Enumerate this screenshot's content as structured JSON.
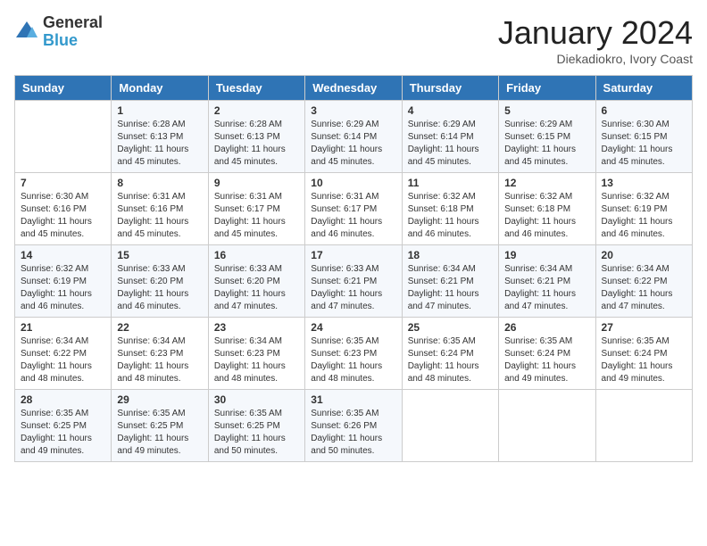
{
  "logo": {
    "general": "General",
    "blue": "Blue"
  },
  "title": "January 2024",
  "subtitle": "Diekadiokro, Ivory Coast",
  "weekdays": [
    "Sunday",
    "Monday",
    "Tuesday",
    "Wednesday",
    "Thursday",
    "Friday",
    "Saturday"
  ],
  "weeks": [
    [
      {
        "day": "",
        "text": ""
      },
      {
        "day": "1",
        "text": "Sunrise: 6:28 AM\nSunset: 6:13 PM\nDaylight: 11 hours\nand 45 minutes."
      },
      {
        "day": "2",
        "text": "Sunrise: 6:28 AM\nSunset: 6:13 PM\nDaylight: 11 hours\nand 45 minutes."
      },
      {
        "day": "3",
        "text": "Sunrise: 6:29 AM\nSunset: 6:14 PM\nDaylight: 11 hours\nand 45 minutes."
      },
      {
        "day": "4",
        "text": "Sunrise: 6:29 AM\nSunset: 6:14 PM\nDaylight: 11 hours\nand 45 minutes."
      },
      {
        "day": "5",
        "text": "Sunrise: 6:29 AM\nSunset: 6:15 PM\nDaylight: 11 hours\nand 45 minutes."
      },
      {
        "day": "6",
        "text": "Sunrise: 6:30 AM\nSunset: 6:15 PM\nDaylight: 11 hours\nand 45 minutes."
      }
    ],
    [
      {
        "day": "7",
        "text": "Sunrise: 6:30 AM\nSunset: 6:16 PM\nDaylight: 11 hours\nand 45 minutes."
      },
      {
        "day": "8",
        "text": "Sunrise: 6:31 AM\nSunset: 6:16 PM\nDaylight: 11 hours\nand 45 minutes."
      },
      {
        "day": "9",
        "text": "Sunrise: 6:31 AM\nSunset: 6:17 PM\nDaylight: 11 hours\nand 45 minutes."
      },
      {
        "day": "10",
        "text": "Sunrise: 6:31 AM\nSunset: 6:17 PM\nDaylight: 11 hours\nand 46 minutes."
      },
      {
        "day": "11",
        "text": "Sunrise: 6:32 AM\nSunset: 6:18 PM\nDaylight: 11 hours\nand 46 minutes."
      },
      {
        "day": "12",
        "text": "Sunrise: 6:32 AM\nSunset: 6:18 PM\nDaylight: 11 hours\nand 46 minutes."
      },
      {
        "day": "13",
        "text": "Sunrise: 6:32 AM\nSunset: 6:19 PM\nDaylight: 11 hours\nand 46 minutes."
      }
    ],
    [
      {
        "day": "14",
        "text": "Sunrise: 6:32 AM\nSunset: 6:19 PM\nDaylight: 11 hours\nand 46 minutes."
      },
      {
        "day": "15",
        "text": "Sunrise: 6:33 AM\nSunset: 6:20 PM\nDaylight: 11 hours\nand 46 minutes."
      },
      {
        "day": "16",
        "text": "Sunrise: 6:33 AM\nSunset: 6:20 PM\nDaylight: 11 hours\nand 47 minutes."
      },
      {
        "day": "17",
        "text": "Sunrise: 6:33 AM\nSunset: 6:21 PM\nDaylight: 11 hours\nand 47 minutes."
      },
      {
        "day": "18",
        "text": "Sunrise: 6:34 AM\nSunset: 6:21 PM\nDaylight: 11 hours\nand 47 minutes."
      },
      {
        "day": "19",
        "text": "Sunrise: 6:34 AM\nSunset: 6:21 PM\nDaylight: 11 hours\nand 47 minutes."
      },
      {
        "day": "20",
        "text": "Sunrise: 6:34 AM\nSunset: 6:22 PM\nDaylight: 11 hours\nand 47 minutes."
      }
    ],
    [
      {
        "day": "21",
        "text": "Sunrise: 6:34 AM\nSunset: 6:22 PM\nDaylight: 11 hours\nand 48 minutes."
      },
      {
        "day": "22",
        "text": "Sunrise: 6:34 AM\nSunset: 6:23 PM\nDaylight: 11 hours\nand 48 minutes."
      },
      {
        "day": "23",
        "text": "Sunrise: 6:34 AM\nSunset: 6:23 PM\nDaylight: 11 hours\nand 48 minutes."
      },
      {
        "day": "24",
        "text": "Sunrise: 6:35 AM\nSunset: 6:23 PM\nDaylight: 11 hours\nand 48 minutes."
      },
      {
        "day": "25",
        "text": "Sunrise: 6:35 AM\nSunset: 6:24 PM\nDaylight: 11 hours\nand 48 minutes."
      },
      {
        "day": "26",
        "text": "Sunrise: 6:35 AM\nSunset: 6:24 PM\nDaylight: 11 hours\nand 49 minutes."
      },
      {
        "day": "27",
        "text": "Sunrise: 6:35 AM\nSunset: 6:24 PM\nDaylight: 11 hours\nand 49 minutes."
      }
    ],
    [
      {
        "day": "28",
        "text": "Sunrise: 6:35 AM\nSunset: 6:25 PM\nDaylight: 11 hours\nand 49 minutes."
      },
      {
        "day": "29",
        "text": "Sunrise: 6:35 AM\nSunset: 6:25 PM\nDaylight: 11 hours\nand 49 minutes."
      },
      {
        "day": "30",
        "text": "Sunrise: 6:35 AM\nSunset: 6:25 PM\nDaylight: 11 hours\nand 50 minutes."
      },
      {
        "day": "31",
        "text": "Sunrise: 6:35 AM\nSunset: 6:26 PM\nDaylight: 11 hours\nand 50 minutes."
      },
      {
        "day": "",
        "text": ""
      },
      {
        "day": "",
        "text": ""
      },
      {
        "day": "",
        "text": ""
      }
    ]
  ]
}
